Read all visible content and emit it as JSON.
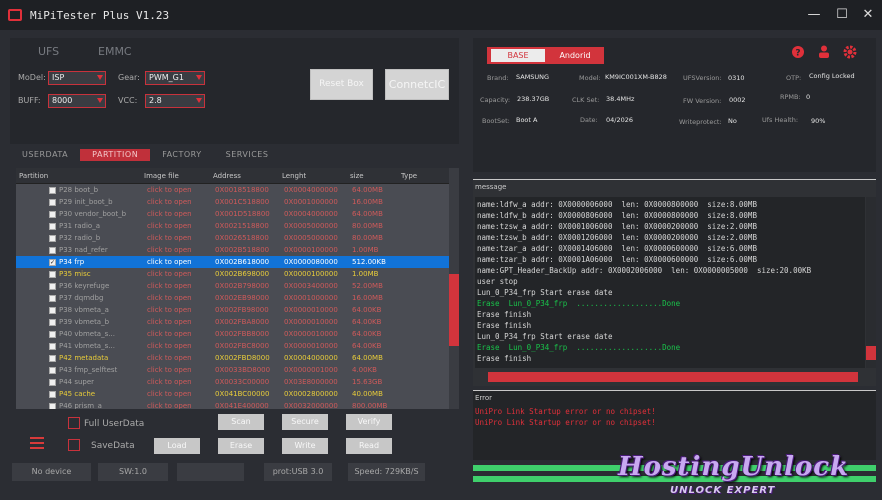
{
  "app": {
    "title": "MiPiTester Plus V1.23"
  },
  "window_controls": {
    "minimize": "—",
    "maximize": "☐",
    "close": "✕"
  },
  "storage_tabs": [
    "UFS",
    "EMMC"
  ],
  "config": {
    "model_label": "MoDel:",
    "model_value": "ISP",
    "gear_label": "Gear:",
    "gear_value": "PWM_G1",
    "buff_label": "BUFF:",
    "buff_value": "8000",
    "vcc_label": "VCC:",
    "vcc_value": "2.8",
    "reset_label": "Reset Box",
    "connect_label": "ConnetcIC"
  },
  "tabs": [
    "USERDATA",
    "PARTITION",
    "FACTORY",
    "SERVICES"
  ],
  "active_tab": "PARTITION",
  "partition_table": {
    "columns": [
      "Partition",
      "Image file",
      "Address",
      "Lenght",
      "size",
      "Type"
    ],
    "rows": [
      {
        "name": "P28 boot_b",
        "image": "click to open",
        "address": "0X0018518800",
        "length": "0X0004000000",
        "size": "64.00MB",
        "highlight": false,
        "selected": false,
        "checked": false
      },
      {
        "name": "P29 init_boot_b",
        "image": "click to open",
        "address": "0X001C518800",
        "length": "0X0001000000",
        "size": "16.00MB",
        "highlight": false,
        "selected": false,
        "checked": false
      },
      {
        "name": "P30 vendor_boot_b",
        "image": "click to open",
        "address": "0X001D518800",
        "length": "0X0004000000",
        "size": "64.00MB",
        "highlight": false,
        "selected": false,
        "checked": false
      },
      {
        "name": "P31 radio_a",
        "image": "click to open",
        "address": "0X0021518800",
        "length": "0X0005000000",
        "size": "80.00MB",
        "highlight": false,
        "selected": false,
        "checked": false
      },
      {
        "name": "P32 radio_b",
        "image": "click to open",
        "address": "0X0026518800",
        "length": "0X0005000000",
        "size": "80.00MB",
        "highlight": false,
        "selected": false,
        "checked": false
      },
      {
        "name": "P33 nad_refer",
        "image": "click to open",
        "address": "0X002B518800",
        "length": "0X0000100000",
        "size": "1.00MB",
        "highlight": false,
        "selected": false,
        "checked": false
      },
      {
        "name": "P34 frp",
        "image": "click to open",
        "address": "0X002B618000",
        "length": "0X0000080000",
        "size": "512.00KB",
        "highlight": false,
        "selected": true,
        "checked": true
      },
      {
        "name": "P35 misc",
        "image": "click to open",
        "address": "0X002B698000",
        "length": "0X0000100000",
        "size": "1.00MB",
        "highlight": true,
        "selected": false,
        "checked": false
      },
      {
        "name": "P36 keyrefuge",
        "image": "click to open",
        "address": "0X002B798000",
        "length": "0X0003400000",
        "size": "52.00MB",
        "highlight": false,
        "selected": false,
        "checked": false
      },
      {
        "name": "P37 dqmdbg",
        "image": "click to open",
        "address": "0X002EB98000",
        "length": "0X0001000000",
        "size": "16.00MB",
        "highlight": false,
        "selected": false,
        "checked": false
      },
      {
        "name": "P38 vbmeta_a",
        "image": "click to open",
        "address": "0X002FB98000",
        "length": "0X0000010000",
        "size": "64.00KB",
        "highlight": false,
        "selected": false,
        "checked": false
      },
      {
        "name": "P39 vbmeta_b",
        "image": "click to open",
        "address": "0X002FBA8000",
        "length": "0X0000010000",
        "size": "64.00KB",
        "highlight": false,
        "selected": false,
        "checked": false
      },
      {
        "name": "P40 vbmeta_s...",
        "image": "click to open",
        "address": "0X002FBB8000",
        "length": "0X0000010000",
        "size": "64.00KB",
        "highlight": false,
        "selected": false,
        "checked": false
      },
      {
        "name": "P41 vbmeta_s...",
        "image": "click to open",
        "address": "0X002FBC8000",
        "length": "0X0000010000",
        "size": "64.00KB",
        "highlight": false,
        "selected": false,
        "checked": false
      },
      {
        "name": "P42 metadata",
        "image": "click to open",
        "address": "0X002FBD8000",
        "length": "0X0004000000",
        "size": "64.00MB",
        "highlight": true,
        "selected": false,
        "checked": false
      },
      {
        "name": "P43 fmp_selftest",
        "image": "click to open",
        "address": "0X0033BD8000",
        "length": "0X0000001000",
        "size": "4.00KB",
        "highlight": false,
        "selected": false,
        "checked": false
      },
      {
        "name": "P44 super",
        "image": "click to open",
        "address": "0X0033C00000",
        "length": "0X03E8000000",
        "size": "15.63GB",
        "highlight": false,
        "selected": false,
        "checked": false
      },
      {
        "name": "P45 cache",
        "image": "click to open",
        "address": "0X041BC00000",
        "length": "0X0002800000",
        "size": "40.00MB",
        "highlight": true,
        "selected": false,
        "checked": false
      },
      {
        "name": "P46 prism_a",
        "image": "click to open",
        "address": "0X041E400000",
        "length": "0X0032000000",
        "size": "800.00MB",
        "highlight": false,
        "selected": false,
        "checked": false
      }
    ]
  },
  "actions": {
    "full_userdata": "Full UserData",
    "save_data": "SaveData",
    "scan": "Scan",
    "secure": "Secure",
    "verify": "Verify",
    "load": "Load",
    "erase": "Erase",
    "write": "Write",
    "read": "Read"
  },
  "status_bar": {
    "device": "No device",
    "sw": "SW:1.0",
    "blank": "",
    "prot": "prot:USB 3.0",
    "speed": "Speed: 729KB/S"
  },
  "info": {
    "base_tab": "BASE",
    "android_tab": "Andorid",
    "brand_label": "Brand:",
    "brand": "SAMSUNG",
    "model_label": "Model:",
    "model": "KM9IC001XM-B828",
    "ufs_label": "UFSVersion:",
    "ufs": "0310",
    "otp_label": "OTP:",
    "otp": "Config Locked",
    "rpmb_label": "RPMB:",
    "rpmb": "0",
    "capacity_label": "Capacity:",
    "capacity": "238.37GB",
    "clk_label": "CLK Set:",
    "clk": "38.4MHz",
    "fw_label": "FW Version:",
    "fw": "0002",
    "bootset_label": "BootSet:",
    "bootset": "Boot A",
    "date_label": "Date:",
    "date": "04/2026",
    "wp_label": "Writeprotect:",
    "wp": "No",
    "health_label": "Ufs Health:",
    "health": "90%"
  },
  "message": {
    "title": "message",
    "lines": [
      {
        "text": "name:ldfw_a addr: 0X0000006000  len: 0X0000800000  size:8.00MB",
        "color": "normal"
      },
      {
        "text": "name:ldfw_b addr: 0X0000806000  len: 0X0000800000  size:8.00MB",
        "color": "normal"
      },
      {
        "text": "name:tzsw_a addr: 0X0001006000  len: 0X0000200000  size:2.00MB",
        "color": "normal"
      },
      {
        "text": "name:tzsw_b addr: 0X0001206000  len: 0X0000200000  size:2.00MB",
        "color": "normal"
      },
      {
        "text": "name:tzar_a addr: 0X0001406000  len: 0X0000600000  size:6.00MB",
        "color": "normal"
      },
      {
        "text": "name:tzar_b addr: 0X0001A06000  len: 0X0000600000  size:6.00MB",
        "color": "normal"
      },
      {
        "text": "name:GPT_Header_BackUp addr: 0X0002006000  len: 0X0000005000  size:20.00KB",
        "color": "normal"
      },
      {
        "text": "",
        "color": "normal"
      },
      {
        "text": "user stop",
        "color": "normal"
      },
      {
        "text": "Lun_0_P34_frp Start erase date",
        "color": "normal"
      },
      {
        "text": "Erase  Lun_0_P34_frp  ...................Done",
        "color": "green"
      },
      {
        "text": "Erase finish",
        "color": "normal"
      },
      {
        "text": "Erase finish",
        "color": "normal"
      },
      {
        "text": "Lun_0_P34_frp Start erase date",
        "color": "normal"
      },
      {
        "text": "Erase  Lun_0_P34_frp  ...................Done",
        "color": "green"
      },
      {
        "text": "Erase finish",
        "color": "normal"
      }
    ]
  },
  "error": {
    "title": "Error",
    "lines": [
      "UniPro Link Startup error or no chipset!",
      "UniPro Link Startup error or no chipset!"
    ]
  },
  "watermark": {
    "main": "HostingUnlock",
    "sub": "UNLOCK EXPERT"
  },
  "colors": {
    "accent": "#d2343c",
    "selected": "#1173d8",
    "progress": "#3fd06c",
    "highlight": "#e8cc3a",
    "console_green": "#19c34a"
  }
}
